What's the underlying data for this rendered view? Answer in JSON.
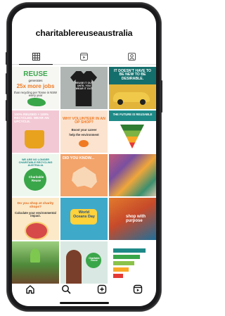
{
  "profile": {
    "username": "charitablereuseaustralia"
  },
  "tabs": [
    {
      "icon": "grid-icon",
      "active": true
    },
    {
      "icon": "reels-icon",
      "active": false
    },
    {
      "icon": "tagged-icon",
      "active": false
    }
  ],
  "posts": {
    "p1": {
      "title": "REUSE",
      "line1": "generates",
      "highlight": "25x more jobs",
      "line2": "than recycling per Tonne in NSW every year"
    },
    "p2": {
      "shirt": "REUSE IT OUT UNTIL YOU WEAR IT OUT"
    },
    "p3": {
      "title": "IT DOESN'T HAVE TO BE NEW TO BE DESIRABLE."
    },
    "p4": {
      "title": "100% REUSED + 100% RECYCLED. WEAR AN UPCYCLE."
    },
    "p5": {
      "title": "WHY VOLUNTEER IN AN OP SHOP?",
      "line1": "Boost your career",
      "line2": "help the environment"
    },
    "p6": {
      "title": "THE FUTURE IS REUSABLE"
    },
    "p7": {
      "title": "WE ARE NO LONGER CHARITABLE RECYCLING AUSTRALIA",
      "brand": "Charitable Reuse"
    },
    "p8": {
      "title": "DID YOU KNOW..."
    },
    "p9": {
      "title": ""
    },
    "p10": {
      "title": "Do you shop at charity shops?",
      "line1": "Calculate your environmental impact."
    },
    "p11": {
      "title": "World Oceans Day"
    },
    "p12": {
      "title": "shop with purpose"
    },
    "p13": {
      "title": ""
    },
    "p14": {
      "brand": "Charitable Reuse"
    },
    "p15": {
      "title": ""
    }
  },
  "bottom_nav": [
    {
      "icon": "home-icon"
    },
    {
      "icon": "search-icon"
    },
    {
      "icon": "create-post-icon"
    },
    {
      "icon": "reels-nav-icon"
    }
  ],
  "colors": {
    "green": "#3aa64a",
    "orange": "#f07a22",
    "teal": "#1e8a87"
  }
}
